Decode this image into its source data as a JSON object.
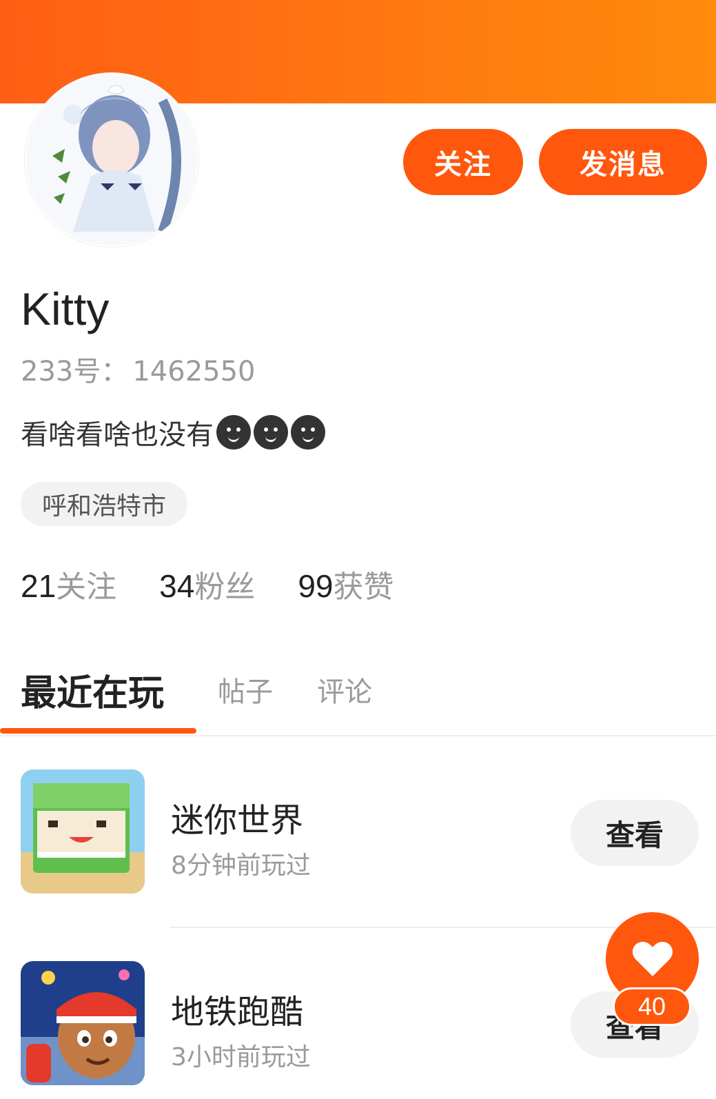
{
  "header": {
    "follow_label": "关注",
    "message_label": "发消息"
  },
  "profile": {
    "username": "Kitty",
    "id_label": "233号：",
    "id_value": "1462550",
    "bio": "看啥看啥也没有",
    "bio_emoji_count": 3,
    "location": "呼和浩特市"
  },
  "stats": [
    {
      "value": "21",
      "label": "关注"
    },
    {
      "value": "34",
      "label": "粉丝"
    },
    {
      "value": "99",
      "label": "获赞"
    }
  ],
  "tabs": [
    {
      "label": "最近在玩",
      "active": true
    },
    {
      "label": "帖子",
      "active": false
    },
    {
      "label": "评论",
      "active": false
    }
  ],
  "games": [
    {
      "name": "迷你世界",
      "played": "8分钟前玩过",
      "action": "查看",
      "icon": "mini-world-icon"
    },
    {
      "name": "地铁跑酷",
      "played": "3小时前玩过",
      "action": "查看",
      "icon": "subway-surfers-icon"
    }
  ],
  "like": {
    "icon": "heart-icon",
    "count": "40"
  },
  "colors": {
    "accent": "#ff570d",
    "banner_start": "#ff5e14",
    "banner_end": "#ff8a0c"
  }
}
